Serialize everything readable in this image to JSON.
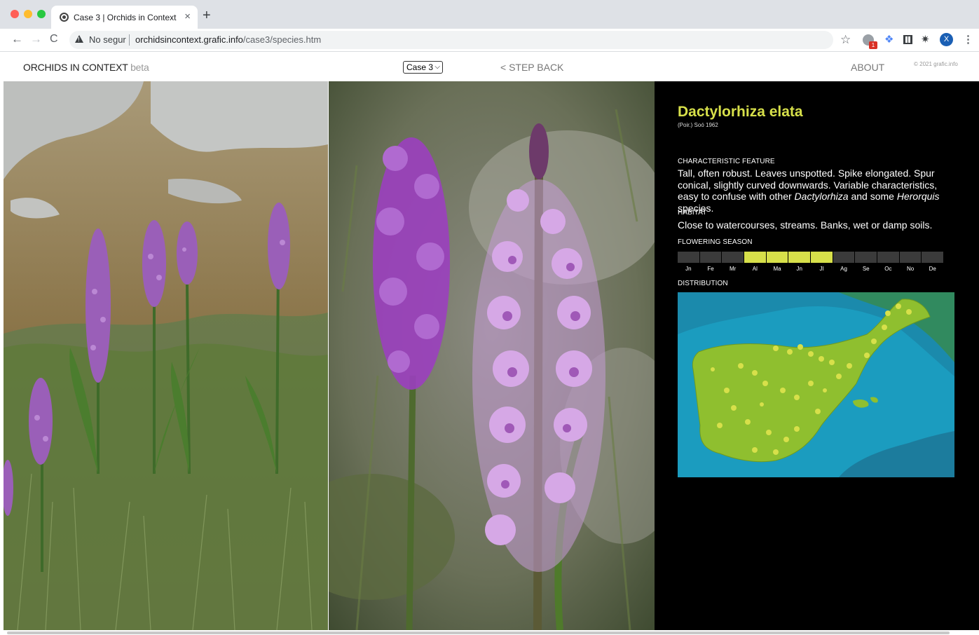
{
  "browser": {
    "tab_title": "Case 3 | Orchids in Context",
    "tab_close": "×",
    "new_tab": "+",
    "nav_back": "←",
    "nav_forward": "→",
    "nav_reload": "C",
    "security_label": "No segur",
    "url_domain": "orchidsincontext.grafic.info",
    "url_path": "/case3/species.htm",
    "star": "☆",
    "extension_badge": "1",
    "profile_initial": "X",
    "menu": "⋮",
    "icons": [
      "globe-icon",
      "warning-icon",
      "star-icon",
      "extension-icon",
      "grid-icon",
      "puzzle-icon",
      "avatar",
      "menu-icon"
    ]
  },
  "header": {
    "brand": "ORCHIDS IN CONTEXT",
    "brand_suffix": "beta",
    "case_select": "Case 3",
    "step_back": "< STEP BACK",
    "about": "ABOUT",
    "copyright": "© 2021 grafic.info"
  },
  "species": {
    "name": "Dactylorhiza elata",
    "authority": "(Poir.) Soó 1962",
    "feature_label": "CHARACTERISTIC FEATURE",
    "feature_text_1": "Tall, often robust. Leaves unspotted. Spike elongated. Spur conical, slightly curved downwards. Variable characteristics, easy to confuse with other ",
    "feature_italic_1": "Dactylorhiza",
    "feature_text_2": " and some ",
    "feature_italic_2": "Herorquis",
    "feature_text_3": " species.",
    "habitat_label": "HABITAT",
    "habitat_text": "Close to watercourses, streams. Banks, wet or damp soils.",
    "season_label": "FLOWERING SEASON",
    "distribution_label": "DISTRIBUTION"
  },
  "season": {
    "months": [
      "Jn",
      "Fe",
      "Mr",
      "Al",
      "Ma",
      "Jn",
      "Jl",
      "Ag",
      "Se",
      "Oc",
      "No",
      "De"
    ],
    "active": [
      false,
      false,
      false,
      true,
      true,
      true,
      true,
      false,
      false,
      false,
      false,
      false
    ],
    "active_color": "#d7e04a",
    "inactive_color": "#3b3b3b"
  },
  "colors": {
    "accent": "#d7e04a",
    "panel_bg": "#000000",
    "sea": "#1b9cbf",
    "land": "#8fbf2f"
  }
}
